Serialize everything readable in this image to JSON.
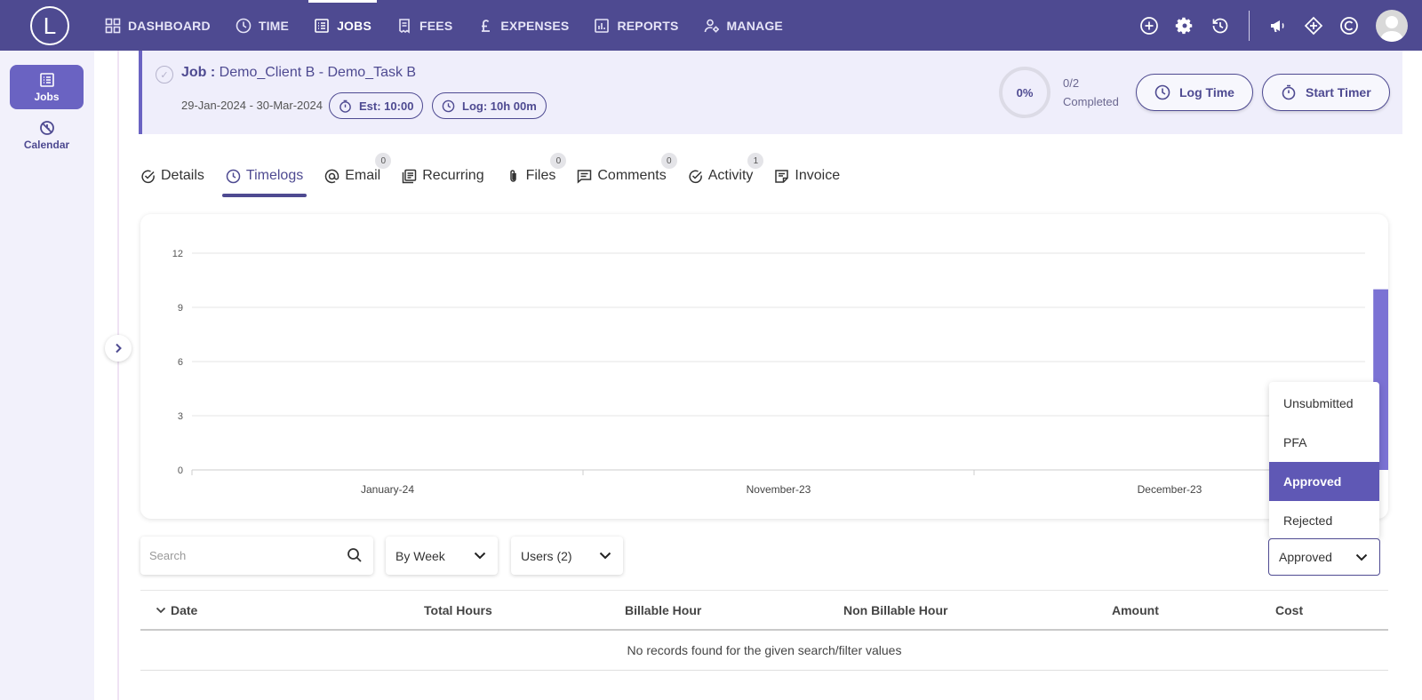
{
  "app": {
    "logo_letter": "L"
  },
  "nav": [
    {
      "label": "DASHBOARD",
      "icon": "dashboard-icon"
    },
    {
      "label": "TIME",
      "icon": "clock-icon"
    },
    {
      "label": "JOBS",
      "icon": "jobs-list-icon",
      "active": true
    },
    {
      "label": "FEES",
      "icon": "fees-icon"
    },
    {
      "label": "EXPENSES",
      "icon": "pound-icon"
    },
    {
      "label": "REPORTS",
      "icon": "reports-icon"
    },
    {
      "label": "MANAGE",
      "icon": "manage-icon"
    }
  ],
  "sidebar": {
    "items": [
      {
        "label": "Jobs",
        "icon": "jobs-list-icon",
        "active": true
      },
      {
        "label": "Calendar",
        "icon": "calendar-off-icon"
      }
    ]
  },
  "job": {
    "title_prefix": "Job :",
    "title": "Demo_Client B - Demo_Task B",
    "dates": "29-Jan-2024 - 30-Mar-2024",
    "est": "Est: 10:00",
    "log": "Log: 10h 00m",
    "progress_percent": "0%",
    "progress_count": "0/2",
    "progress_label": "Completed",
    "log_time_label": "Log Time",
    "start_timer_label": "Start Timer"
  },
  "tabs": [
    {
      "label": "Details",
      "icon": "check-circle-icon"
    },
    {
      "label": "Timelogs",
      "icon": "clock-icon",
      "active": true
    },
    {
      "label": "Email",
      "icon": "at-icon",
      "badge": "0"
    },
    {
      "label": "Recurring",
      "icon": "recurring-icon"
    },
    {
      "label": "Files",
      "icon": "paperclip-icon",
      "badge": "0"
    },
    {
      "label": "Comments",
      "icon": "comment-icon",
      "badge": "0"
    },
    {
      "label": "Activity",
      "icon": "check-circle-icon",
      "badge": "1"
    },
    {
      "label": "Invoice",
      "icon": "invoice-icon"
    }
  ],
  "chart_data": {
    "type": "bar",
    "categories": [
      "January-24",
      "November-23",
      "December-23"
    ],
    "values": [
      0,
      0,
      10
    ],
    "ylim": [
      0,
      12
    ],
    "yticks": [
      0,
      3,
      6,
      9,
      12
    ],
    "grid": true,
    "bar_color": "#7b72d4"
  },
  "status_dropdown": {
    "options": [
      "Unsubmitted",
      "PFA",
      "Approved",
      "Rejected"
    ],
    "selected": "Approved"
  },
  "filters": {
    "search_placeholder": "Search",
    "period": "By Week",
    "users": "Users (2)",
    "status": "Approved"
  },
  "table": {
    "columns": [
      "Date",
      "Total Hours",
      "Billable Hour",
      "Non Billable Hour",
      "Amount",
      "Cost"
    ],
    "empty_message": "No records found for the given search/filter values"
  },
  "colors": {
    "brand": "#4e4a91",
    "accent": "#6a63c2"
  }
}
